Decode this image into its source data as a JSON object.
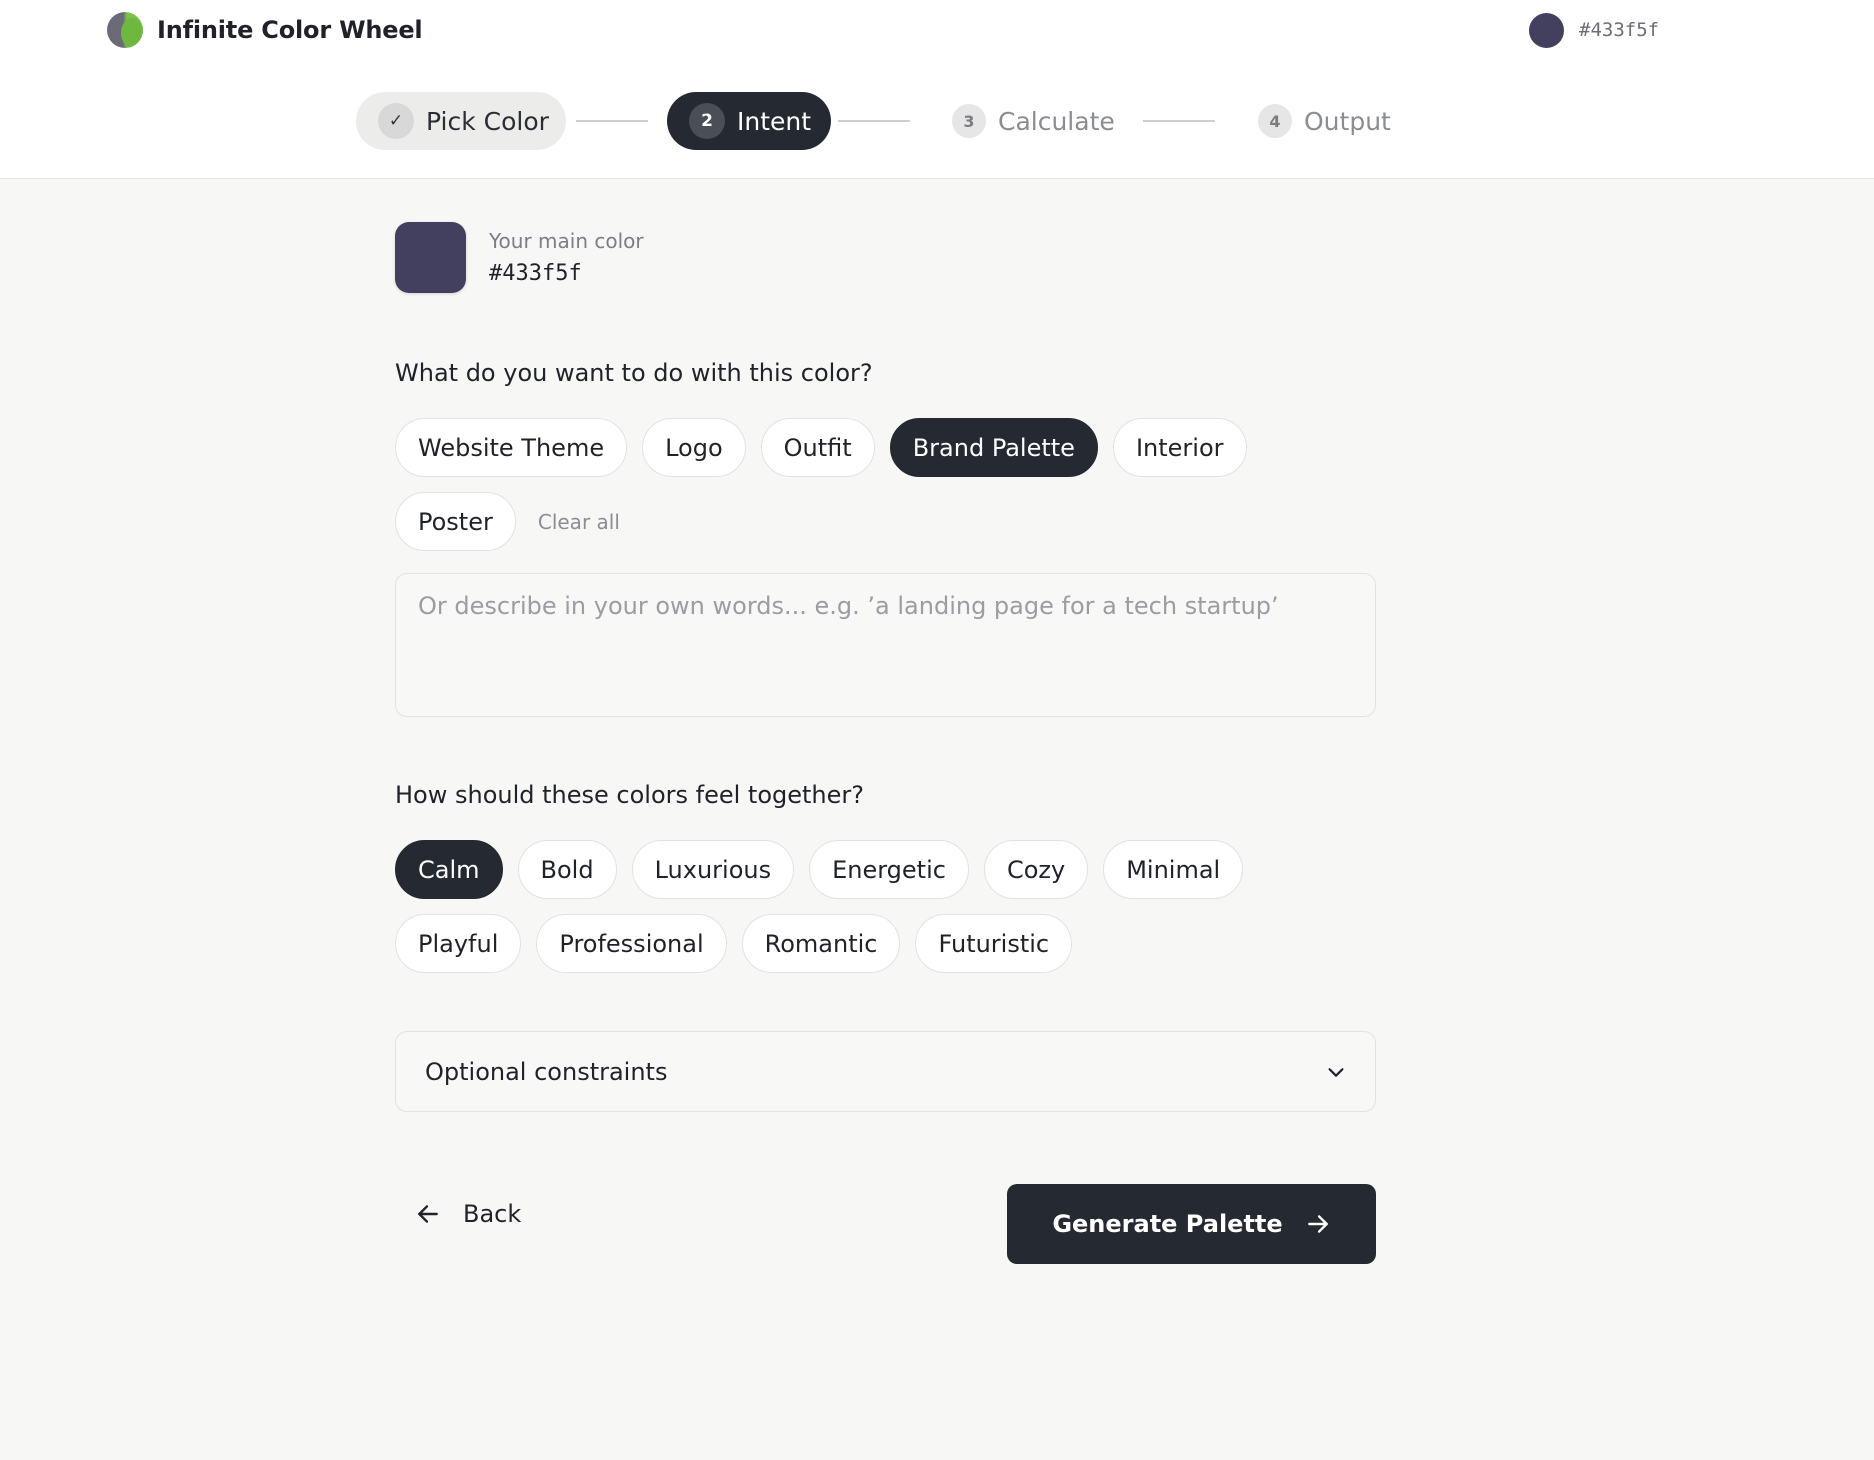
{
  "app": {
    "title": "Infinite Color Wheel"
  },
  "header": {
    "current_color_hex": "#433f5f"
  },
  "stepper": {
    "steps": [
      {
        "number": "✓",
        "label": "Pick Color",
        "state": "done"
      },
      {
        "number": "2",
        "label": "Intent",
        "state": "active"
      },
      {
        "number": "3",
        "label": "Calculate",
        "state": "todo"
      },
      {
        "number": "4",
        "label": "Output",
        "state": "todo"
      }
    ]
  },
  "main_color": {
    "caption": "Your main color",
    "hex": "#433f5f",
    "swatch_color": "#433f5f"
  },
  "intent": {
    "question": "What do you want to do with this color?",
    "options": [
      {
        "label": "Website Theme",
        "selected": false
      },
      {
        "label": "Logo",
        "selected": false
      },
      {
        "label": "Outfit",
        "selected": false
      },
      {
        "label": "Brand Palette",
        "selected": true
      },
      {
        "label": "Interior",
        "selected": false
      },
      {
        "label": "Poster",
        "selected": false
      }
    ],
    "clear_label": "Clear all",
    "description_placeholder": "Or describe in your own words... e.g. ’a landing page for a tech startup’",
    "description_value": ""
  },
  "feel": {
    "question": "How should these colors feel together?",
    "options": [
      {
        "label": "Calm",
        "selected": true
      },
      {
        "label": "Bold",
        "selected": false
      },
      {
        "label": "Luxurious",
        "selected": false
      },
      {
        "label": "Energetic",
        "selected": false
      },
      {
        "label": "Cozy",
        "selected": false
      },
      {
        "label": "Minimal",
        "selected": false
      },
      {
        "label": "Playful",
        "selected": false
      },
      {
        "label": "Professional",
        "selected": false
      },
      {
        "label": "Romantic",
        "selected": false
      },
      {
        "label": "Futuristic",
        "selected": false
      }
    ]
  },
  "constraints": {
    "label": "Optional constraints",
    "icon": "chevron-down-icon"
  },
  "actions": {
    "back_label": "Back",
    "back_icon": "arrow-left-icon",
    "generate_label": "Generate Palette",
    "generate_icon": "arrow-right-icon"
  },
  "colors": {
    "accent_dark": "#252932",
    "main": "#433f5f",
    "logo_green": "#7cc24a"
  }
}
